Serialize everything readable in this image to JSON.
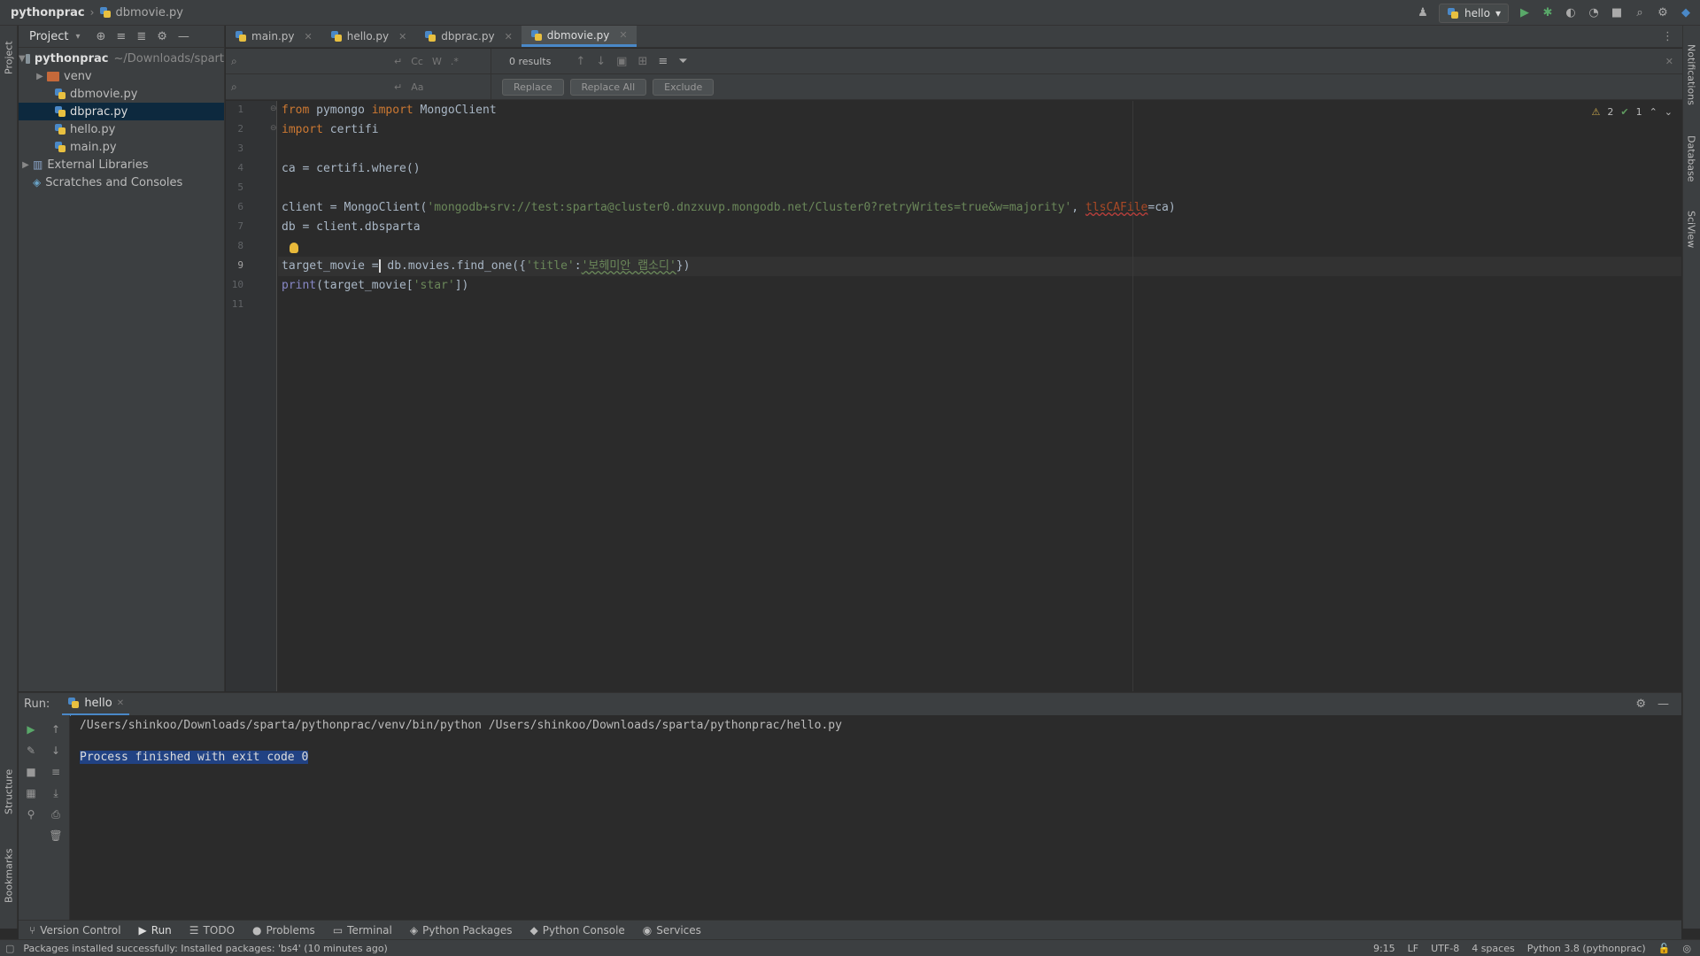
{
  "titlebar": {
    "project": "pythonprac",
    "file": "dbmovie.py",
    "run_config": "hello"
  },
  "project_panel": {
    "title": "Project",
    "root_name": "pythonprac",
    "root_path": "~/Downloads/spart",
    "items": [
      {
        "label": "venv"
      },
      {
        "label": "dbmovie.py"
      },
      {
        "label": "dbprac.py"
      },
      {
        "label": "hello.py"
      },
      {
        "label": "main.py"
      },
      {
        "label": "External Libraries"
      },
      {
        "label": "Scratches and Consoles"
      }
    ]
  },
  "tabs": [
    {
      "label": "main.py"
    },
    {
      "label": "hello.py"
    },
    {
      "label": "dbprac.py"
    },
    {
      "label": "dbmovie.py"
    }
  ],
  "find": {
    "results": "0 results",
    "opt_case": "Cc",
    "opt_word": "W",
    "opt_regex": ".*",
    "replace_label": "Replace",
    "replace_all_label": "Replace All",
    "exclude_label": "Exclude"
  },
  "editor": {
    "line_numbers": [
      "1",
      "2",
      "3",
      "4",
      "5",
      "6",
      "7",
      "8",
      "9",
      "10",
      "11"
    ],
    "warnings": "2",
    "checks": "1",
    "code": {
      "l1_kw1": "from",
      "l1_mod": " pymongo ",
      "l1_kw2": "import",
      "l1_name": " MongoClient",
      "l2_kw": "import",
      "l2_name": " certifi",
      "l4": "ca = certifi.where()",
      "l6_a": "client = MongoClient(",
      "l6_str": "'mongodb+srv://test:sparta@cluster0.dnzxuvp.mongodb.net/Cluster0?retryWrites=true&w=majority'",
      "l6_b": ", ",
      "l6_param": "tlsCAFile",
      "l6_c": "=ca)",
      "l7": "db = client.dbsparta",
      "l9_a": "target_movie =",
      "l9_b": " db.movies.find_one({",
      "l9_str1": "'title'",
      "l9_c": ":",
      "l9_str2": "'보헤미안 랩소디'",
      "l9_d": "})",
      "l10_fn": "print",
      "l10_a": "(target_movie[",
      "l10_str": "'star'",
      "l10_b": "])"
    }
  },
  "run": {
    "label": "Run:",
    "tab": "hello",
    "command": "/Users/shinkoo/Downloads/sparta/pythonprac/venv/bin/python /Users/shinkoo/Downloads/sparta/pythonprac/hello.py",
    "result": "Process finished with exit code 0"
  },
  "tool_windows": [
    {
      "label": "Version Control"
    },
    {
      "label": "Run"
    },
    {
      "label": "TODO"
    },
    {
      "label": "Problems"
    },
    {
      "label": "Terminal"
    },
    {
      "label": "Python Packages"
    },
    {
      "label": "Python Console"
    },
    {
      "label": "Services"
    }
  ],
  "side_tabs": {
    "project": "Project",
    "structure": "Structure",
    "bookmarks": "Bookmarks",
    "notifications": "Notifications",
    "database": "Database",
    "sciview": "SciView"
  },
  "status": {
    "message": "Packages installed successfully: Installed packages: 'bs4' (10 minutes ago)",
    "position": "9:15",
    "line_sep": "LF",
    "encoding": "UTF-8",
    "indent": "4 spaces",
    "interpreter": "Python 3.8 (pythonprac)"
  },
  "colors": {
    "accent": "#4a88c7",
    "selection": "#0d293e",
    "keyword": "#cc7832",
    "string": "#6a8759"
  }
}
